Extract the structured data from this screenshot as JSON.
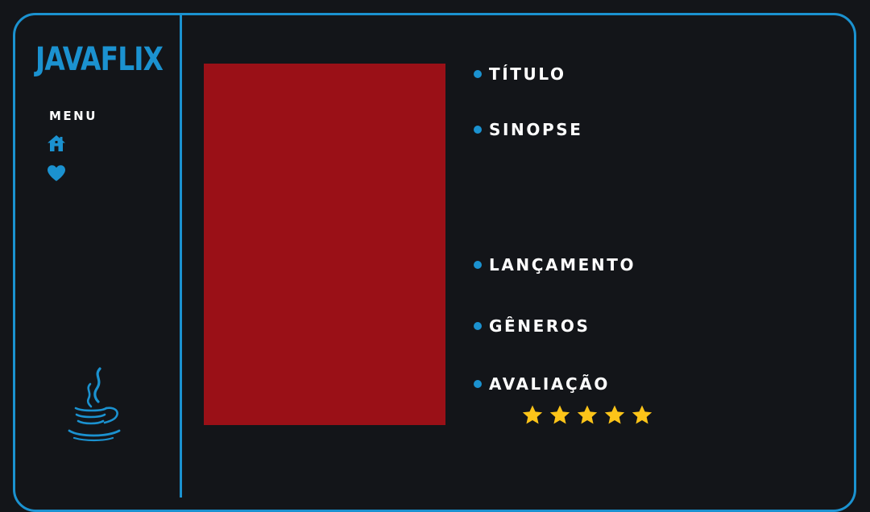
{
  "app": {
    "brand": "JAVAFLIX"
  },
  "sidebar": {
    "menu_label": "MENU",
    "items": [
      {
        "icon": "home-icon"
      },
      {
        "icon": "heart-icon"
      }
    ],
    "footer_logo": "java-coffee-cup-icon"
  },
  "details": {
    "title_label": "TÍTULO",
    "synopsis_label": "SINOPSE",
    "release_label": "LANÇAMENTO",
    "genres_label": "GÊNEROS",
    "rating_label": "AVALIAÇÃO",
    "rating_stars": 5,
    "rating_max": 5
  },
  "colors": {
    "accent": "#1b92d0",
    "background": "#131519",
    "poster": "#9a1017",
    "star": "#fcc419",
    "text": "#ffffff"
  }
}
